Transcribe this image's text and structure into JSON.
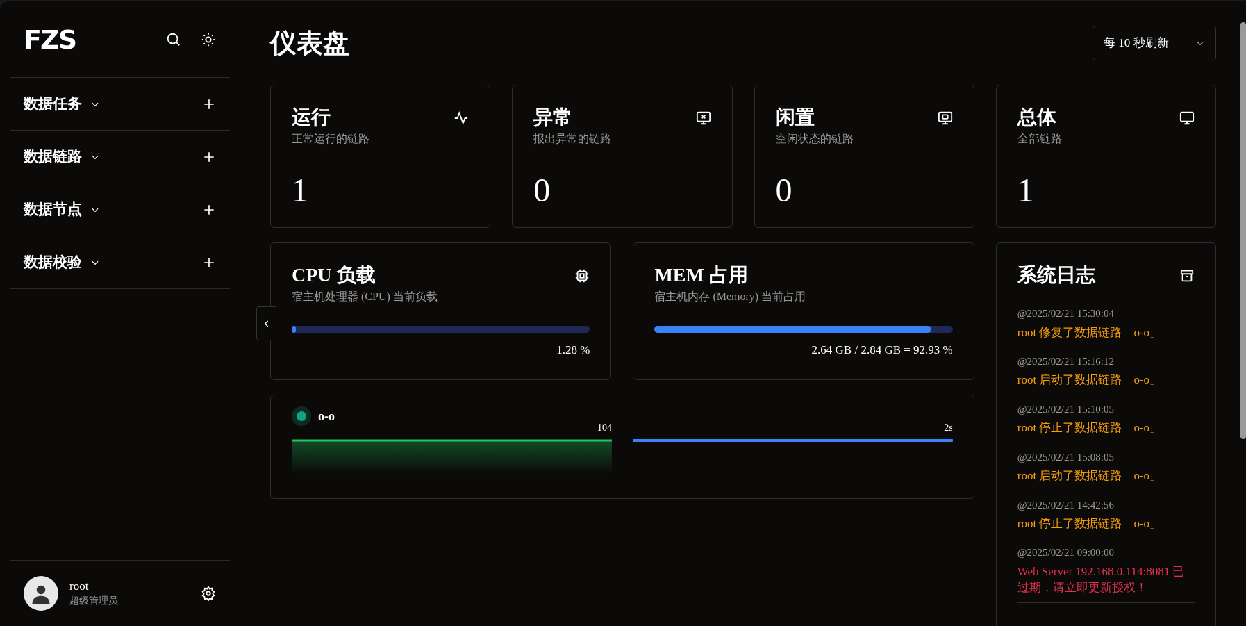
{
  "sidebar": {
    "logo": "FZS",
    "items": [
      {
        "label": "数据任务",
        "expanded": false
      },
      {
        "label": "数据链路",
        "expanded": false
      },
      {
        "label": "数据节点",
        "expanded": false
      },
      {
        "label": "数据校验",
        "expanded": false
      }
    ],
    "user": {
      "name": "root",
      "role": "超级管理员"
    }
  },
  "header": {
    "title": "仪表盘",
    "refresh": "每 10 秒刷新"
  },
  "stats": [
    {
      "kind": "activity",
      "title": "运行",
      "subtitle": "正常运行的链路",
      "value": "1"
    },
    {
      "kind": "error",
      "title": "异常",
      "subtitle": "报出异常的链路",
      "value": "0"
    },
    {
      "kind": "idle",
      "title": "闲置",
      "subtitle": "空闲状态的链路",
      "value": "0"
    },
    {
      "kind": "total",
      "title": "总体",
      "subtitle": "全部链路",
      "value": "1"
    }
  ],
  "meters": [
    {
      "kind": "cpu",
      "title": "CPU 负载",
      "subtitle": "宿主机处理器 (CPU) 当前负载",
      "level": 0.0128,
      "reading": "1.28 %"
    },
    {
      "kind": "mem",
      "title": "MEM 占用",
      "subtitle": "宿主机内存 (Memory) 当前占用",
      "level": 0.9293,
      "reading": "2.64 GB / 2.84 GB = 92.93 %"
    }
  ],
  "link_monitor": {
    "name": "o-o",
    "color": "#10a37f",
    "throughput_label": "104",
    "latency_label": "2s"
  },
  "system_log": {
    "title": "系统日志",
    "entries": [
      {
        "time": "@2025/02/21 15:30:04",
        "message": "root 修复了数据链路「o-o」",
        "color": "#f59e0b"
      },
      {
        "time": "@2025/02/21 15:16:12",
        "message": "root 启动了数据链路「o-o」",
        "color": "#f59e0b"
      },
      {
        "time": "@2025/02/21 15:10:05",
        "message": "root 停止了数据链路「o-o」",
        "color": "#f59e0b"
      },
      {
        "time": "@2025/02/21 15:08:05",
        "message": "root 启动了数据链路「o-o」",
        "color": "#f59e0b"
      },
      {
        "time": "@2025/02/21 14:42:56",
        "message": "root 停止了数据链路「o-o」",
        "color": "#f59e0b"
      },
      {
        "time": "@2025/02/21 09:00:00",
        "message": "Web Server 192.168.0.114:8081 已过期，请立即更新授权！",
        "color": "#e0314b"
      }
    ]
  }
}
